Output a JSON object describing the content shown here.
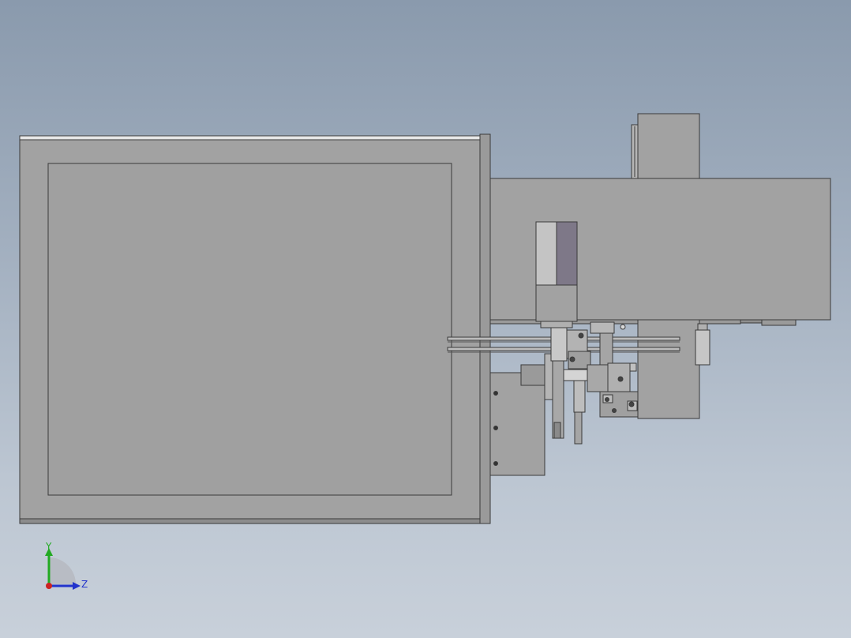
{
  "viewport": {
    "background_top": "#8a9aad",
    "background_bottom": "#c8d0da",
    "part_fill": "#a0a0a0",
    "edge_color": "#3a3a3a"
  },
  "triad": {
    "y_label": "Y",
    "z_label": "Z",
    "y_color": "#22aa22",
    "z_color": "#2233cc",
    "x_color": "#cc2222"
  }
}
